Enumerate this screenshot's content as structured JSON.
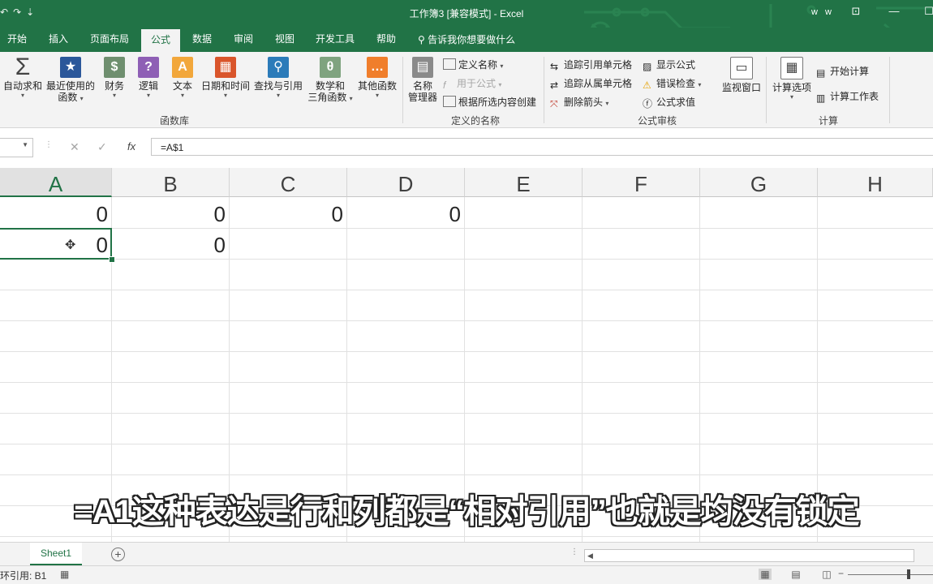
{
  "window": {
    "title": "工作簿3  [兼容模式]  -  Excel",
    "user": "w w",
    "qat_icons": [
      "undo-icon",
      "redo-icon",
      "customize-qat-icon"
    ]
  },
  "tabs": [
    {
      "label": "开始"
    },
    {
      "label": "插入"
    },
    {
      "label": "页面布局"
    },
    {
      "label": "公式",
      "active": true
    },
    {
      "label": "数据"
    },
    {
      "label": "审阅"
    },
    {
      "label": "视图"
    },
    {
      "label": "开发工具"
    },
    {
      "label": "帮助"
    }
  ],
  "tell_me": "告诉我你想要做什么",
  "ribbon": {
    "function_library": {
      "label": "函数库",
      "buttons": [
        {
          "label": "自动求和",
          "icon": "sigma-icon"
        },
        {
          "label": "最近使用的函数",
          "line1": "最近使用的",
          "line2": "函数",
          "icon": "star-icon"
        },
        {
          "label": "财务",
          "icon": "coins-icon"
        },
        {
          "label": "逻辑",
          "icon": "question-icon"
        },
        {
          "label": "文本",
          "icon": "text-a-icon"
        },
        {
          "label": "日期和时间",
          "icon": "calendar-icon"
        },
        {
          "label": "查找与引用",
          "icon": "lookup-icon"
        },
        {
          "label": "数学和三角函数",
          "line1": "数学和",
          "line2": "三角函数",
          "icon": "theta-icon"
        },
        {
          "label": "其他函数",
          "icon": "more-icon"
        }
      ]
    },
    "defined_names": {
      "label": "定义的名称",
      "name_manager_line1": "名称",
      "name_manager_line2": "管理器",
      "define_name": "定义名称",
      "use_in_formula": "用于公式",
      "create_from_selection": "根据所选内容创建"
    },
    "formula_auditing": {
      "label": "公式审核",
      "trace_precedents": "追踪引用单元格",
      "trace_dependents": "追踪从属单元格",
      "remove_arrows": "删除箭头",
      "show_formulas": "显示公式",
      "error_checking": "错误检查",
      "evaluate_formula": "公式求值",
      "watch_window": "监视窗口"
    },
    "calculation": {
      "label": "计算",
      "calc_options": "计算选项",
      "calc_now": "开始计算",
      "calc_sheet": "计算工作表"
    }
  },
  "formula_bar": {
    "name_box": "",
    "formula": "=A$1"
  },
  "grid": {
    "columns": [
      "A",
      "B",
      "C",
      "D",
      "E",
      "F",
      "G",
      "H"
    ],
    "selected_column": "A",
    "rows": [
      [
        "0",
        "0",
        "0",
        "0",
        "",
        "",
        "",
        ""
      ],
      [
        "0",
        "0",
        "",
        "",
        "",
        "",
        "",
        ""
      ]
    ]
  },
  "subtitle": "=A1这种表达是行和列都是“相对引用”也就是均没有锁定",
  "sheets": [
    {
      "label": "Sheet1",
      "active": true
    }
  ],
  "status": {
    "text": "环引用: B1"
  },
  "colors": {
    "brand": "#217346",
    "ribbon_bg": "#f3f3f3"
  }
}
